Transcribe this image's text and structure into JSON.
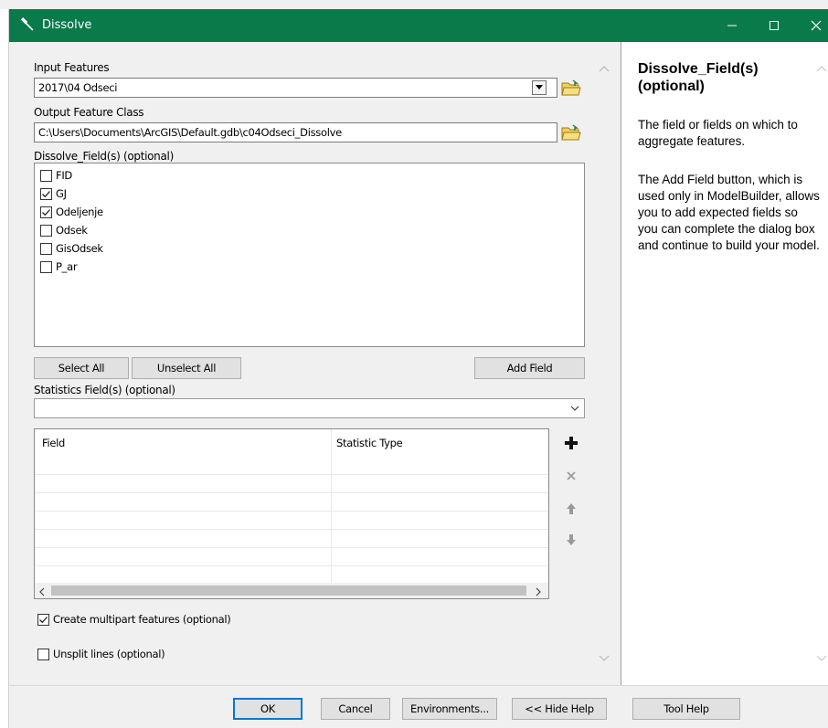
{
  "window": {
    "title": "Dissolve"
  },
  "input_features": {
    "label": "Input Features",
    "value": "2017\\04 Odseci"
  },
  "output_feature_class": {
    "label": "Output Feature Class",
    "value": "C:\\Users\\Documents\\ArcGIS\\Default.gdb\\c04Odseci_Dissolve"
  },
  "dissolve_fields": {
    "label": "Dissolve_Field(s) (optional)",
    "items": [
      {
        "name": "FID",
        "checked": false
      },
      {
        "name": "GJ",
        "checked": true
      },
      {
        "name": "Odeljenje",
        "checked": true
      },
      {
        "name": "Odsek",
        "checked": false
      },
      {
        "name": "GisOdsek",
        "checked": false
      },
      {
        "name": "P_ar",
        "checked": false
      }
    ],
    "select_all": "Select All",
    "unselect_all": "Unselect All",
    "add_field": "Add Field"
  },
  "statistics": {
    "label": "Statistics Field(s) (optional)",
    "value": "",
    "columns": [
      "Field",
      "Statistic Type"
    ]
  },
  "options": {
    "multipart": {
      "label": "Create multipart features (optional)",
      "checked": true
    },
    "unsplit": {
      "label": "Unsplit lines (optional)",
      "checked": false
    }
  },
  "buttons": {
    "ok": "OK",
    "cancel": "Cancel",
    "environments": "Environments...",
    "hide_help": "<< Hide Help",
    "tool_help": "Tool Help"
  },
  "help": {
    "title": "Dissolve_Field(s) (optional)",
    "paragraph1": "The field or fields on which to aggregate features.",
    "paragraph2": "The Add Field button, which is used only in ModelBuilder, allows you to add expected fields so you can complete the dialog box and continue to build your model."
  },
  "colors": {
    "titlebar": "#0a7a4a",
    "window_bg": "#f0f0f0",
    "default_button_border": "#0078d7"
  }
}
